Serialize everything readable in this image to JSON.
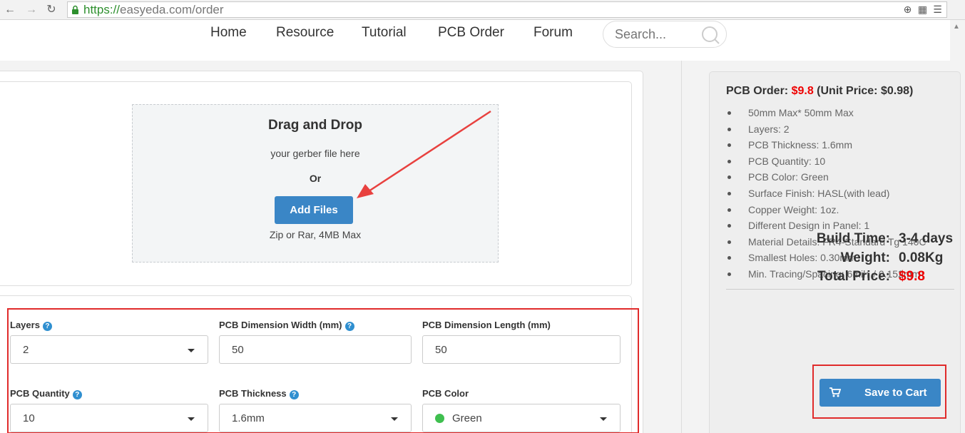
{
  "browser": {
    "url_scheme": "https://",
    "url_rest": "easyeda.com/order"
  },
  "nav": {
    "items": [
      "Home",
      "Resource",
      "Tutorial",
      "PCB Order",
      "Forum"
    ],
    "search_placeholder": "Search..."
  },
  "upload": {
    "title": "Drag and Drop",
    "subtitle": "your gerber file here",
    "or": "Or",
    "button": "Add Files",
    "note": "Zip or Rar, 4MB Max"
  },
  "options": {
    "layers_label": "Layers",
    "layers_value": "2",
    "width_label": "PCB Dimension Width (mm)",
    "width_value": "50",
    "length_label": "PCB Dimension Length (mm)",
    "length_value": "50",
    "quantity_label": "PCB Quantity",
    "quantity_value": "10",
    "thickness_label": "PCB Thickness",
    "thickness_value": "1.6mm",
    "color_label": "PCB Color",
    "color_value": "Green"
  },
  "summary": {
    "order_label": "PCB Order: ",
    "order_price": "$9.8",
    "unit_price": " (Unit Price: $0.98)",
    "specs": [
      "50mm Max* 50mm Max",
      "Layers: 2",
      "PCB Thickness: 1.6mm",
      "PCB Quantity: 10",
      "PCB Color: Green",
      "Surface Finish: HASL(with lead)",
      "Copper Weight: 1oz.",
      "Different Design in Panel: 1",
      "Material Details: FR4-Standard Tg 140C",
      "Smallest Holes: 0.30mm↑",
      "Min. Tracing/Spacing: 6mil↑ / 0.152mm↑"
    ],
    "build_time_label": "Build Time:",
    "build_time_value": "3-4 days",
    "weight_label": "Weight:",
    "weight_value": "0.08Kg",
    "total_label": "Total Price:",
    "total_value": "$9.8",
    "cart_button": "Save to Cart"
  },
  "colors": {
    "accent": "#3a86c6",
    "price": "#ee0000",
    "highlight": "#e02b2b",
    "pcb_green": "#3fbf4f"
  }
}
